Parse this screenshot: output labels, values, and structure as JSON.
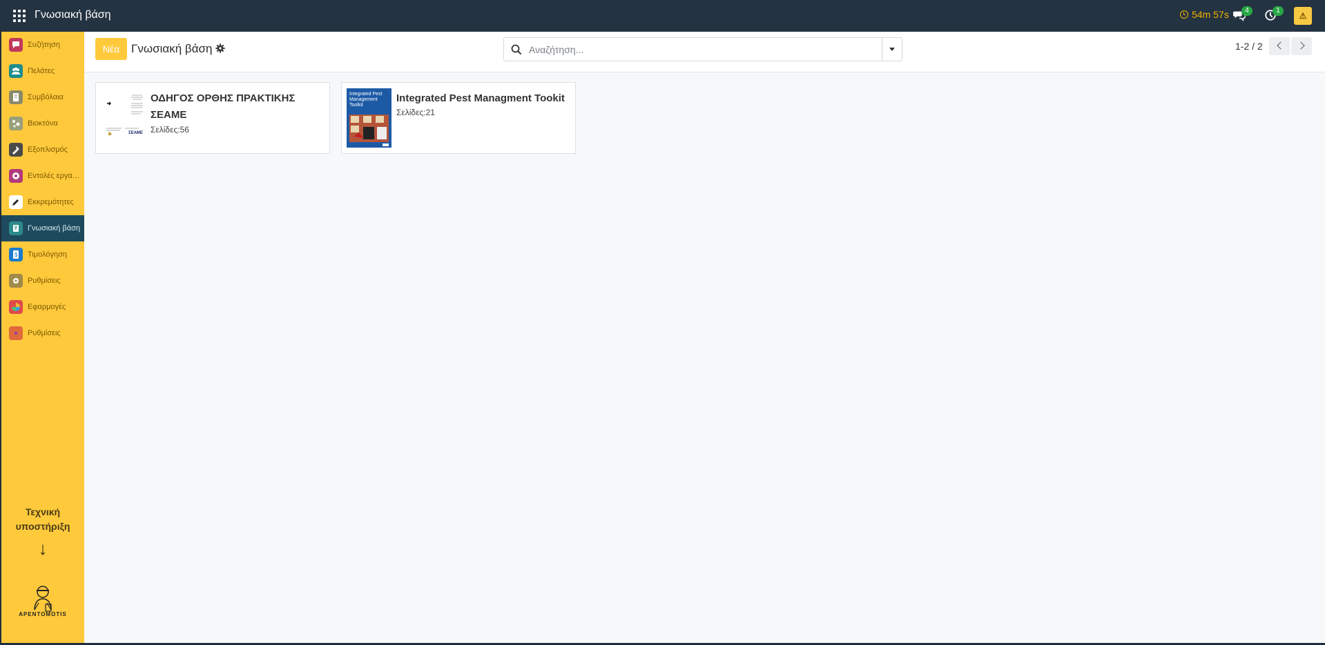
{
  "app": {
    "title": "Γνωσιακή βάση",
    "timer": "54m 57s",
    "messages_badge": "4",
    "activities_badge": "1"
  },
  "sidebar": {
    "items": [
      {
        "label": "Συζήτηση",
        "icon": "chat-icon",
        "color": "#c0395a",
        "active": false
      },
      {
        "label": "Πελάτες",
        "icon": "users-icon",
        "color": "#1e8c8c",
        "active": false
      },
      {
        "label": "Συμβόλαια",
        "icon": "contract-icon",
        "color": "#8a8a6a",
        "active": false
      },
      {
        "label": "Βιοκτόνα",
        "icon": "biocide-icon",
        "color": "#9aa07a",
        "active": false
      },
      {
        "label": "Εξοπλισμός",
        "icon": "tools-icon",
        "color": "#4a4a4a",
        "active": false
      },
      {
        "label": "Εντολές εργασίας",
        "icon": "work-order-icon",
        "color": "#b23a7a",
        "active": false
      },
      {
        "label": "Εκκρεμότητες",
        "icon": "pencil-icon",
        "color": "#ffffff",
        "active": false
      },
      {
        "label": "Γνωσιακή βάση",
        "icon": "knowledge-icon",
        "color": "#2b8a8a",
        "active": true
      },
      {
        "label": "Τιμολόγηση",
        "icon": "invoice-icon",
        "color": "#1a7acb",
        "active": false
      },
      {
        "label": "Ρυθμίσεις",
        "icon": "settings-icon",
        "color": "#a08a4a",
        "active": false
      },
      {
        "label": "Εφαρμογές",
        "icon": "apps-grid-icon",
        "color": "#e04a4a",
        "active": false
      },
      {
        "label": "Ρυθμίσεις",
        "icon": "odoo-settings-icon",
        "color": "#e06a3a",
        "active": false
      }
    ],
    "support_label": "Τεχνική υποστήριξη",
    "support_arrow": "↓",
    "logo_text": "ΑΡΕΝΤΟΜΟΤΙS"
  },
  "control_panel": {
    "new_button": "Νέα",
    "breadcrumb": "Γνωσιακή βάση",
    "search_placeholder": "Αναζήτηση...",
    "pager": "1-2 / 2"
  },
  "cards": [
    {
      "title": "ΟΔΗΓΟΣ ΟΡΘΗΣ ΠΡΑΚΤΙΚΗΣ ΣΕΑΜΕ",
      "pages_label": "Σελίδες:",
      "pages": "56"
    },
    {
      "title": "Integrated Pest Managment Tookit",
      "pages_label": "Σελίδες:",
      "pages": "21",
      "cover_text": "Integrated Pest Management Toolkit"
    }
  ],
  "colors": {
    "topbar": "#243342",
    "sidebar": "#ffc93c",
    "accent": "#ffc93c",
    "active_item": "#1e4a5e"
  }
}
